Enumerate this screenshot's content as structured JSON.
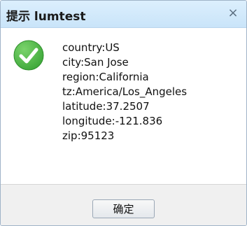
{
  "dialog": {
    "title": "提示 lumtest",
    "close_label": "×",
    "icon": "success-check-icon",
    "accent_color": "#3ea83a",
    "lines": [
      "country:US",
      "city:San Jose",
      "region:California",
      "tz:America/Los_Angeles",
      "latitude:37.2507",
      "longitude:-121.836",
      "zip:95123"
    ],
    "ok_label": "确定"
  }
}
